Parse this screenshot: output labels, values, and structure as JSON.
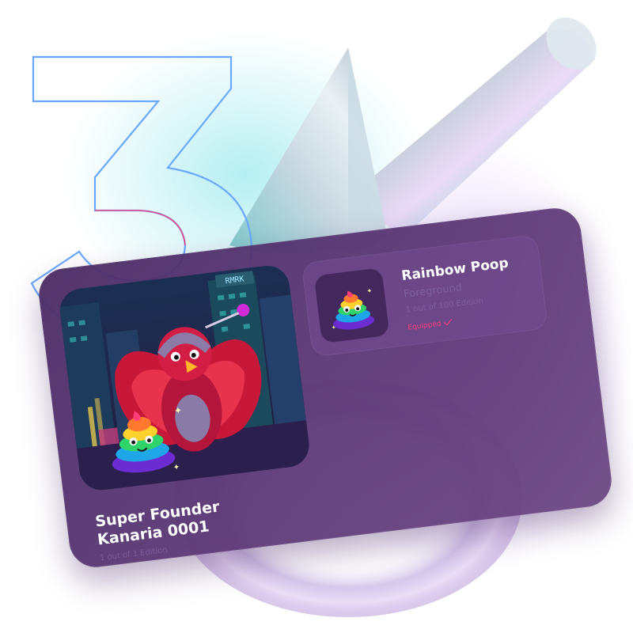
{
  "graphic": {
    "step_number": "3",
    "accent_outline": "#6aa8ff",
    "accent_magenta": "#ff3e78"
  },
  "nft_card": {
    "title_line1": "Super Founder",
    "title_line2": "Kanaria 0001",
    "edition": "1 out of 1 Edition",
    "image_icon": "red-bird-robot-illustration",
    "background_sign": "RMRK"
  },
  "equipped_item": {
    "name": "Rainbow Poop",
    "category": "Foreground",
    "edition": "1 out of 100 Edition",
    "status": "Equipped",
    "status_icon": "check-icon",
    "thumbnail_icon": "rainbow-poop-icon"
  },
  "colors": {
    "card_bg": "#4e2f68",
    "panel_bg": "#6b4a86",
    "muted_text": "#7e61a0",
    "status": "#ff3e78"
  }
}
